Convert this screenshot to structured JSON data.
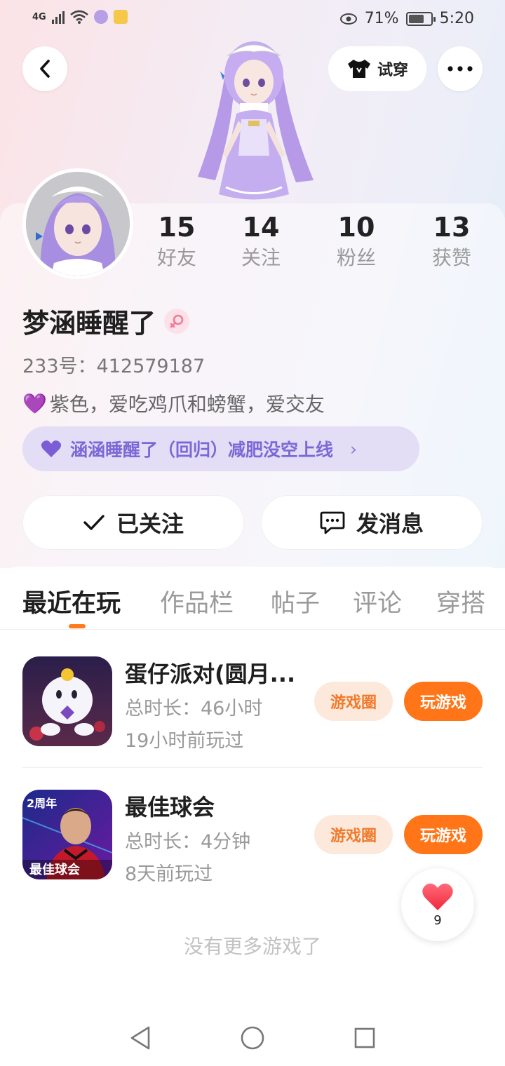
{
  "status_bar": {
    "network": "4G",
    "battery": "71%",
    "battery_level": 0.71,
    "time": "5:20"
  },
  "header": {
    "back_icon": "back-chevron-icon",
    "try_on_label": "试穿",
    "more_icon": "more-dots-icon"
  },
  "stats": [
    {
      "value": "15",
      "label": "好友"
    },
    {
      "value": "14",
      "label": "关注"
    },
    {
      "value": "10",
      "label": "粉丝"
    },
    {
      "value": "13",
      "label": "获赞"
    }
  ],
  "profile": {
    "name": "梦涵睡醒了",
    "uid": "233号：412579187",
    "bio_emoji": "💜",
    "bio": "紫色，爱吃鸡爪和螃蟹，爱交友",
    "status": "涵涵睡醒了（回归）减肥没空上线"
  },
  "actions": {
    "followed": "已关注",
    "message": "发消息"
  },
  "tabs": [
    {
      "label": "最近在玩",
      "active": true
    },
    {
      "label": "作品栏",
      "active": false
    },
    {
      "label": "帖子",
      "active": false
    },
    {
      "label": "评论",
      "active": false
    },
    {
      "label": "穿搭",
      "active": false
    }
  ],
  "games": [
    {
      "title": "蛋仔派对(圆月...",
      "total_time": "总时长：46小时",
      "last_played": "19小时前玩过",
      "circle_label": "游戏圈",
      "play_label": "玩游戏"
    },
    {
      "title": "最佳球会",
      "total_time": "总时长：4分钟",
      "last_played": "8天前玩过",
      "circle_label": "游戏圈",
      "play_label": "玩游戏",
      "icon_badge": "2周年",
      "icon_caption": "最佳球会"
    }
  ],
  "no_more_text": "没有更多游戏了",
  "like": {
    "count": "9"
  },
  "colors": {
    "accent": "#ff7517",
    "status_pill_bg": "#e3ddf6",
    "status_pill_text": "#7c68d6"
  }
}
